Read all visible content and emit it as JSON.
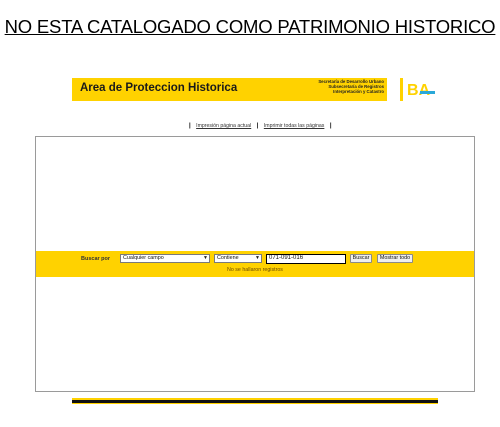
{
  "heading": "NO ESTA CATALOGADO COMO PATRIMONIO HISTORICO",
  "banner": {
    "title": "Area de Proteccion Historica",
    "subtitle_lines": [
      "Secretaría de Desarrollo Urbano",
      "Subsecretaría de Registros",
      "Interpretación y Catastro"
    ],
    "logo_text": "BA",
    "accent_color": "#ffd200",
    "logo_color": "#2aa8d8"
  },
  "print_links": {
    "current_page": "Impresión página actual",
    "all_pages": "Imprimir todas las páginas",
    "separator": "|"
  },
  "search": {
    "label": "Buscar por",
    "field_select": "Cualquier campo",
    "operator_select": "Contiene",
    "query_value": "071-091-016",
    "search_button": "Buscar",
    "show_all_button": "Mostrar todo",
    "status": "No se hallaron registros"
  }
}
